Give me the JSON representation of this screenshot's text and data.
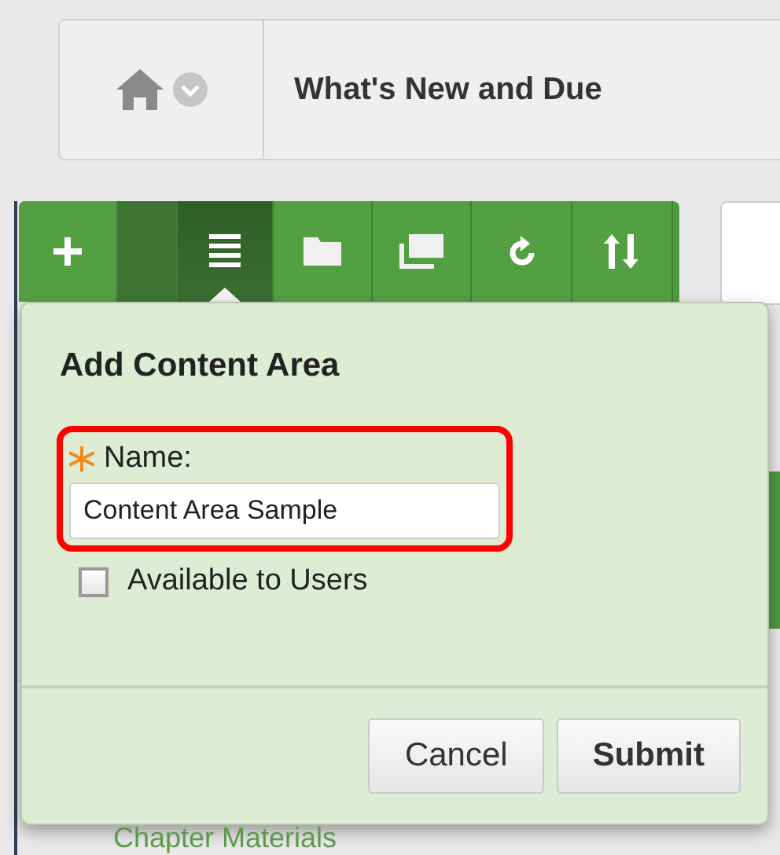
{
  "breadcrumb": {
    "title": "What's New and Due"
  },
  "toolbar": [
    {
      "kind": "add",
      "selected": false
    },
    {
      "kind": "spacer",
      "selected": false
    },
    {
      "kind": "list",
      "selected": true
    },
    {
      "kind": "folder",
      "selected": false
    },
    {
      "kind": "windows",
      "selected": false
    },
    {
      "kind": "refresh",
      "selected": false
    },
    {
      "kind": "sort",
      "selected": false
    }
  ],
  "dialog": {
    "title": "Add Content Area",
    "field": {
      "label": "Name:",
      "value": "Content Area Sample"
    },
    "checkbox": {
      "label": "Available to Users",
      "checked": false
    },
    "buttons": [
      {
        "label": "Cancel",
        "kind": "secondary"
      },
      {
        "label": "Submit",
        "kind": "primary"
      }
    ]
  },
  "menu_items": [
    "Chapter Materials"
  ]
}
